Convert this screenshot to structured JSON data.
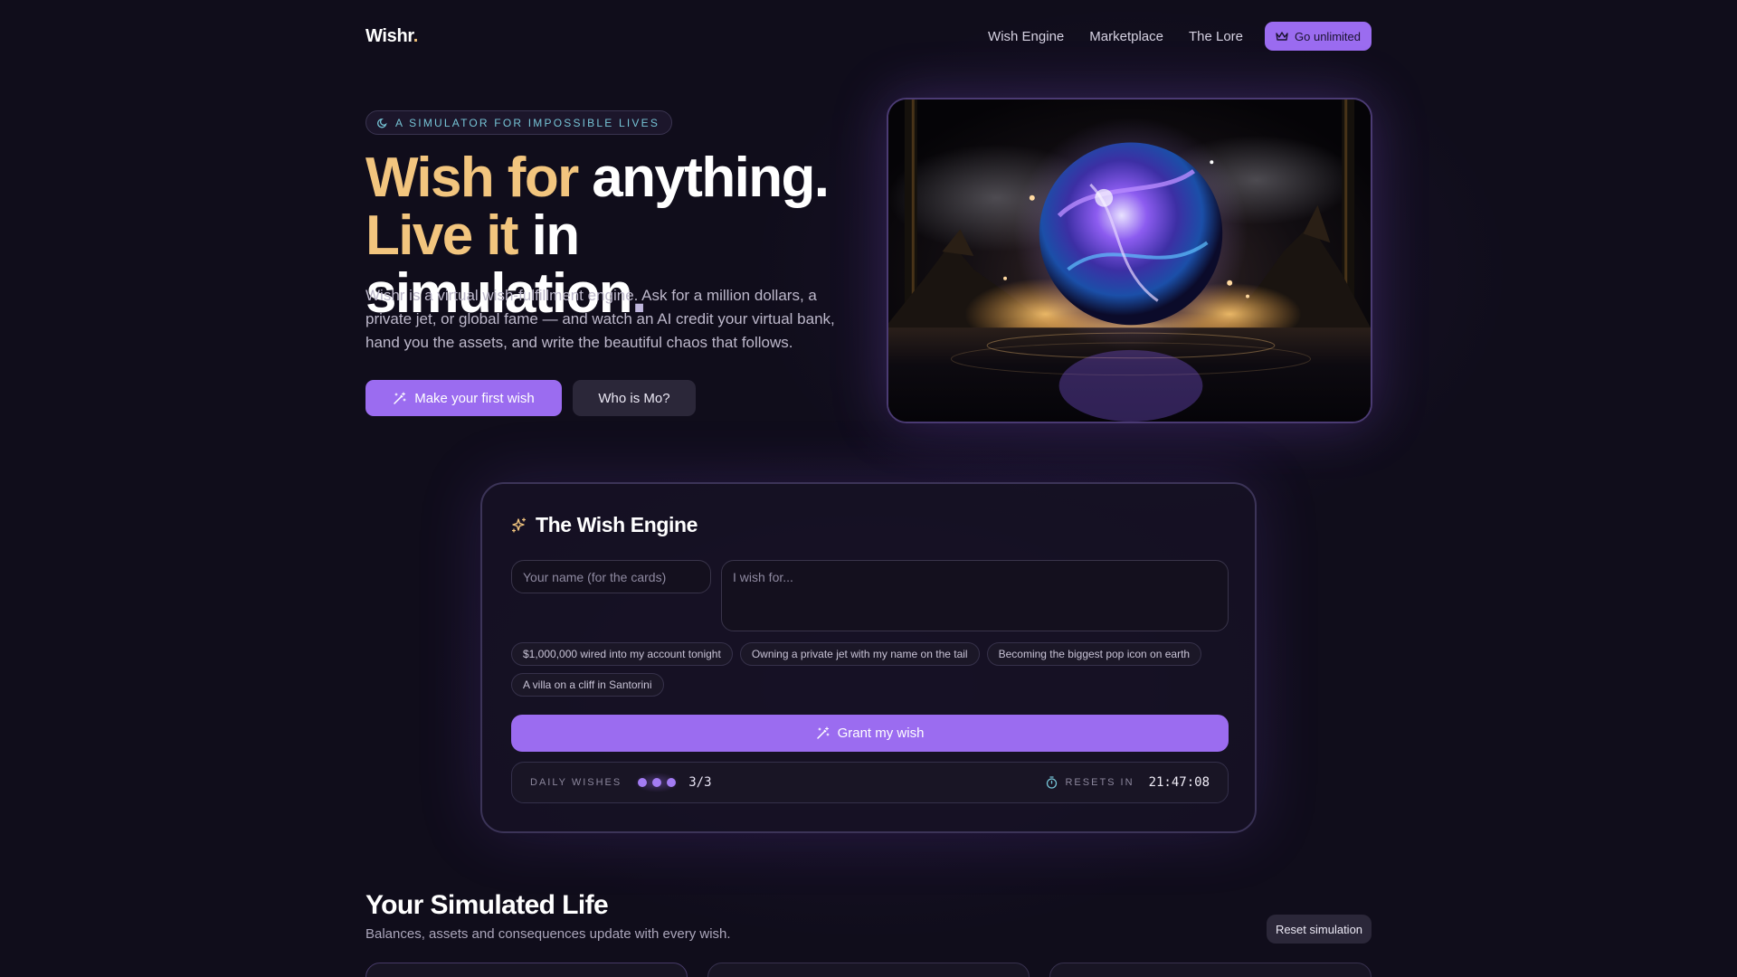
{
  "nav": {
    "logo_text": "Wishr",
    "logo_dot": ".",
    "links": [
      "Wish Engine",
      "Marketplace",
      "The Lore"
    ],
    "cta_label": "Go unlimited",
    "cta_icon": "crown-icon"
  },
  "hero": {
    "badge": "A SIMULATOR FOR IMPOSSIBLE LIVES",
    "badge_icon": "moon-icon",
    "title_line1_gold": "Wish for",
    "title_line1_rest": " anything.",
    "title_line2_gold": "Live it",
    "title_line2_rest": " in simulation",
    "title_line2_end": ".",
    "description": "Wishr is a virtual wish-fulfillment engine. Ask for a million dollars, a private jet, or global fame — and watch an AI credit your virtual bank, hand you the assets, and write the beautiful chaos that follows.",
    "primary_button": "Make your first wish",
    "primary_icon": "magic-wand-icon",
    "secondary_button": "Who is Mo?",
    "image_subject": "glowing crystal orb over reflective water"
  },
  "engine": {
    "title": "The Wish Engine",
    "title_icon": "sparkles-icon",
    "name_placeholder": "Your name (for the cards)",
    "wish_placeholder": "I wish for...",
    "suggestions": [
      "$1,000,000 wired into my account tonight",
      "Owning a private jet with my name on the tail",
      "Becoming the biggest pop icon on earth",
      "A villa on a cliff in Santorini"
    ],
    "grant_button": "Grant my wish",
    "daily_label": "DAILY WISHES",
    "daily_used": 3,
    "daily_total": 3,
    "daily_count": "3/3",
    "resets_label": "RESETS IN",
    "resets_icon": "timer-icon",
    "resets_time": "21:47:08"
  },
  "life": {
    "title": "Your Simulated Life",
    "subtitle": "Balances, assets and consequences update with every wish.",
    "reset_button": "Reset simulation"
  },
  "colors": {
    "background": "#100d1b",
    "accent": "#9b6cf0",
    "gold": "#f2c57e",
    "badge_text": "#76c4d6"
  }
}
